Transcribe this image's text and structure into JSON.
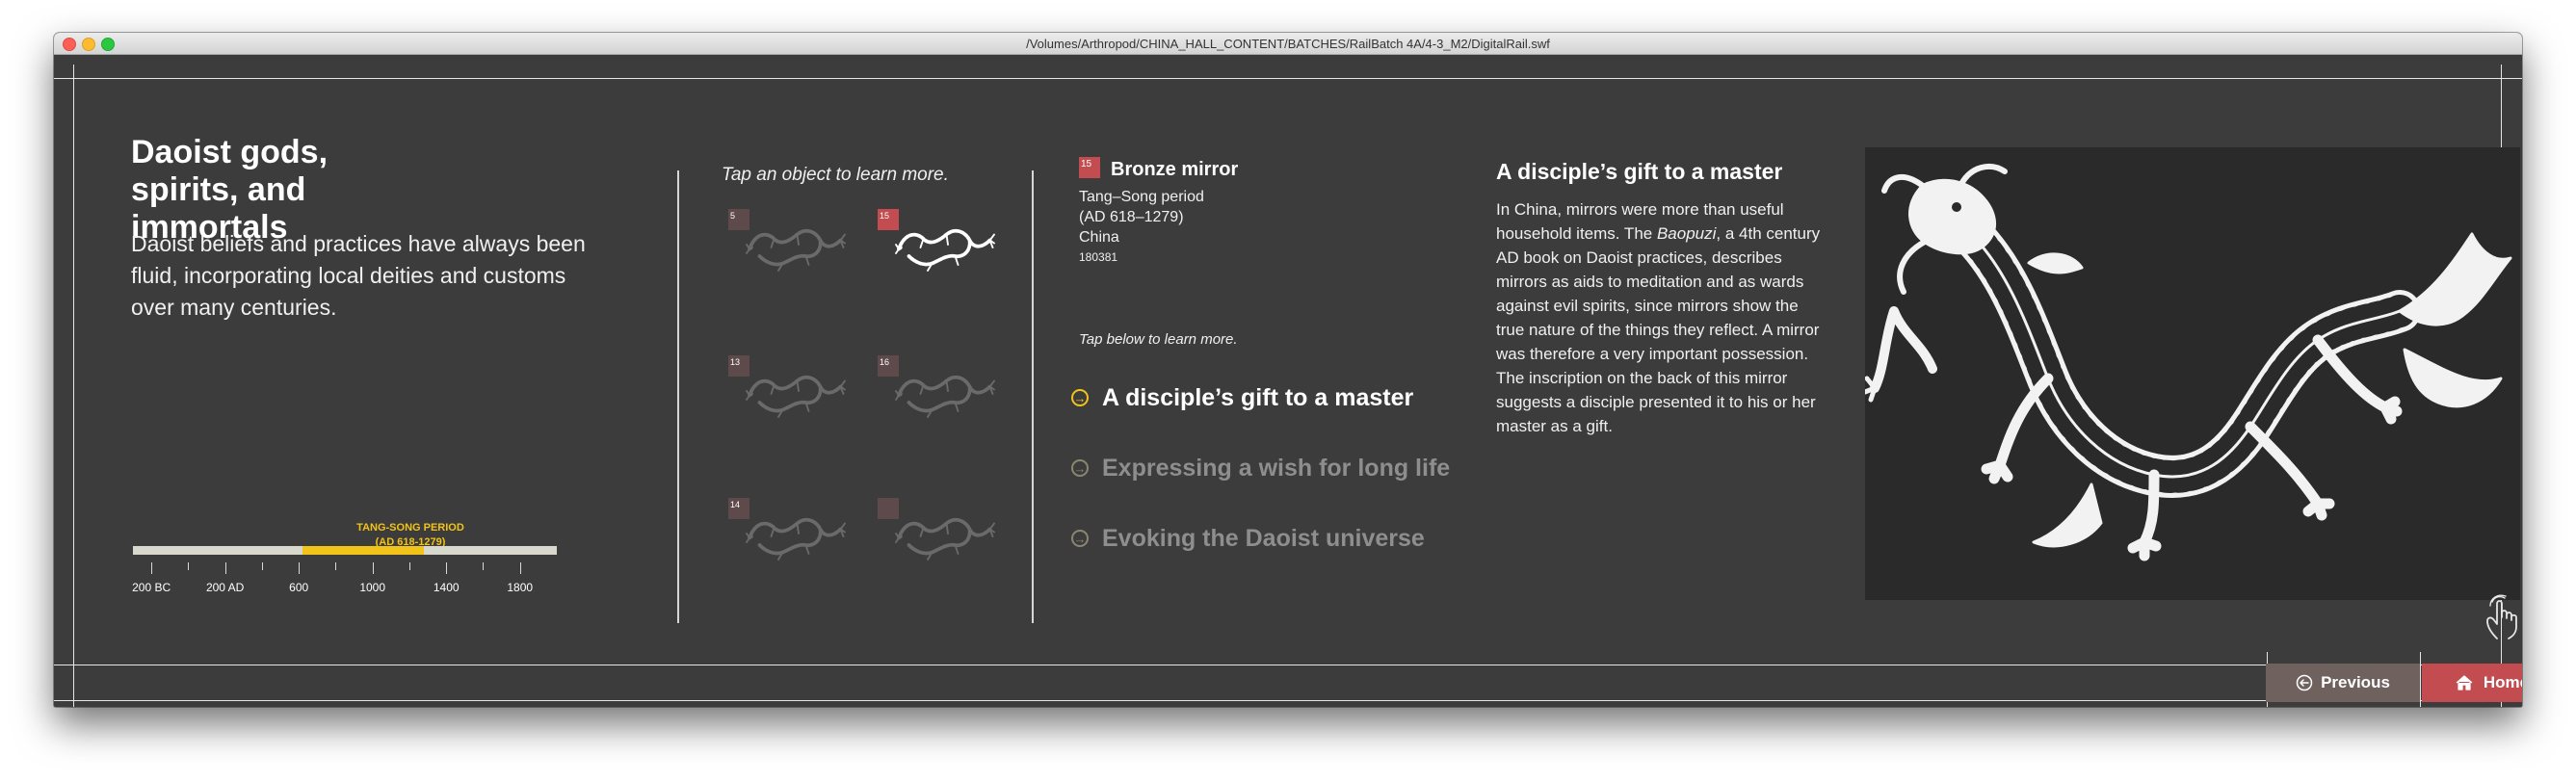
{
  "window": {
    "title": "/Volumes/Arthropod/CHINA_HALL_CONTENT/BATCHES/RailBatch 4A/4-3_M2/DigitalRail.swf"
  },
  "section": {
    "title": "Daoist gods, spirits, and immortals",
    "intro": "Daoist beliefs and practices have always been fluid, incorporating local deities and customs over many centuries."
  },
  "timeline": {
    "period_label": "TANG-SONG PERIOD",
    "period_range": "(AD 618-1279)",
    "highlight_range": [
      618,
      1279
    ],
    "axis_range": [
      -300,
      2000
    ],
    "labels": [
      {
        "text": "200 BC",
        "year": -200
      },
      {
        "text": "200 AD",
        "year": 200
      },
      {
        "text": "600",
        "year": 600
      },
      {
        "text": "1000",
        "year": 1000
      },
      {
        "text": "1400",
        "year": 1400
      },
      {
        "text": "1800",
        "year": 1800
      }
    ],
    "highlight_color": "#f2c318"
  },
  "gallery": {
    "hint": "Tap an object to learn more.",
    "thumbnails": [
      {
        "badge": "5",
        "selected": false
      },
      {
        "badge": "15",
        "selected": true
      },
      {
        "badge": "13",
        "selected": false
      },
      {
        "badge": "16",
        "selected": false
      },
      {
        "badge": "14",
        "selected": false
      },
      {
        "badge": "",
        "selected": false
      }
    ]
  },
  "object": {
    "number": "15",
    "name": "Bronze mirror",
    "period": "Tang–Song period",
    "dates": "(AD 618–1279)",
    "origin": "China",
    "catalog": "180381"
  },
  "topics": {
    "hint": "Tap below to learn more.",
    "items": [
      {
        "label": "A disciple’s gift to a master",
        "active": true,
        "icon": "arrow-circle-icon"
      },
      {
        "label": "Expressing a wish for long life",
        "active": false,
        "icon": "arrow-circle-icon"
      },
      {
        "label": "Evoking the Daoist universe",
        "active": false,
        "icon": "arrow-circle-icon"
      }
    ]
  },
  "story": {
    "title": "A disciple’s gift to a master",
    "body_before": "In China, mirrors were more than useful household items. The ",
    "body_book": "Baopuzi",
    "body_after": ", a 4th century AD book on Daoist practices, describes mirrors as aids to meditation and as wards against evil spirits, since mirrors show the true nature of the things they reflect. A mirror was therefore a very important possession. The inscription on the back of this mirror suggests a disciple presented it to his or her master as a gift."
  },
  "nav": {
    "previous_label": "Previous",
    "home_label": "Home",
    "previous_icon": "arrow-left-circle-icon",
    "home_icon": "house-icon"
  },
  "colors": {
    "background": "#3c3c3c",
    "accent_yellow": "#f2c318",
    "badge_red": "#c24c50",
    "previous_button": "#6e615e",
    "home_button": "#c24c50"
  }
}
